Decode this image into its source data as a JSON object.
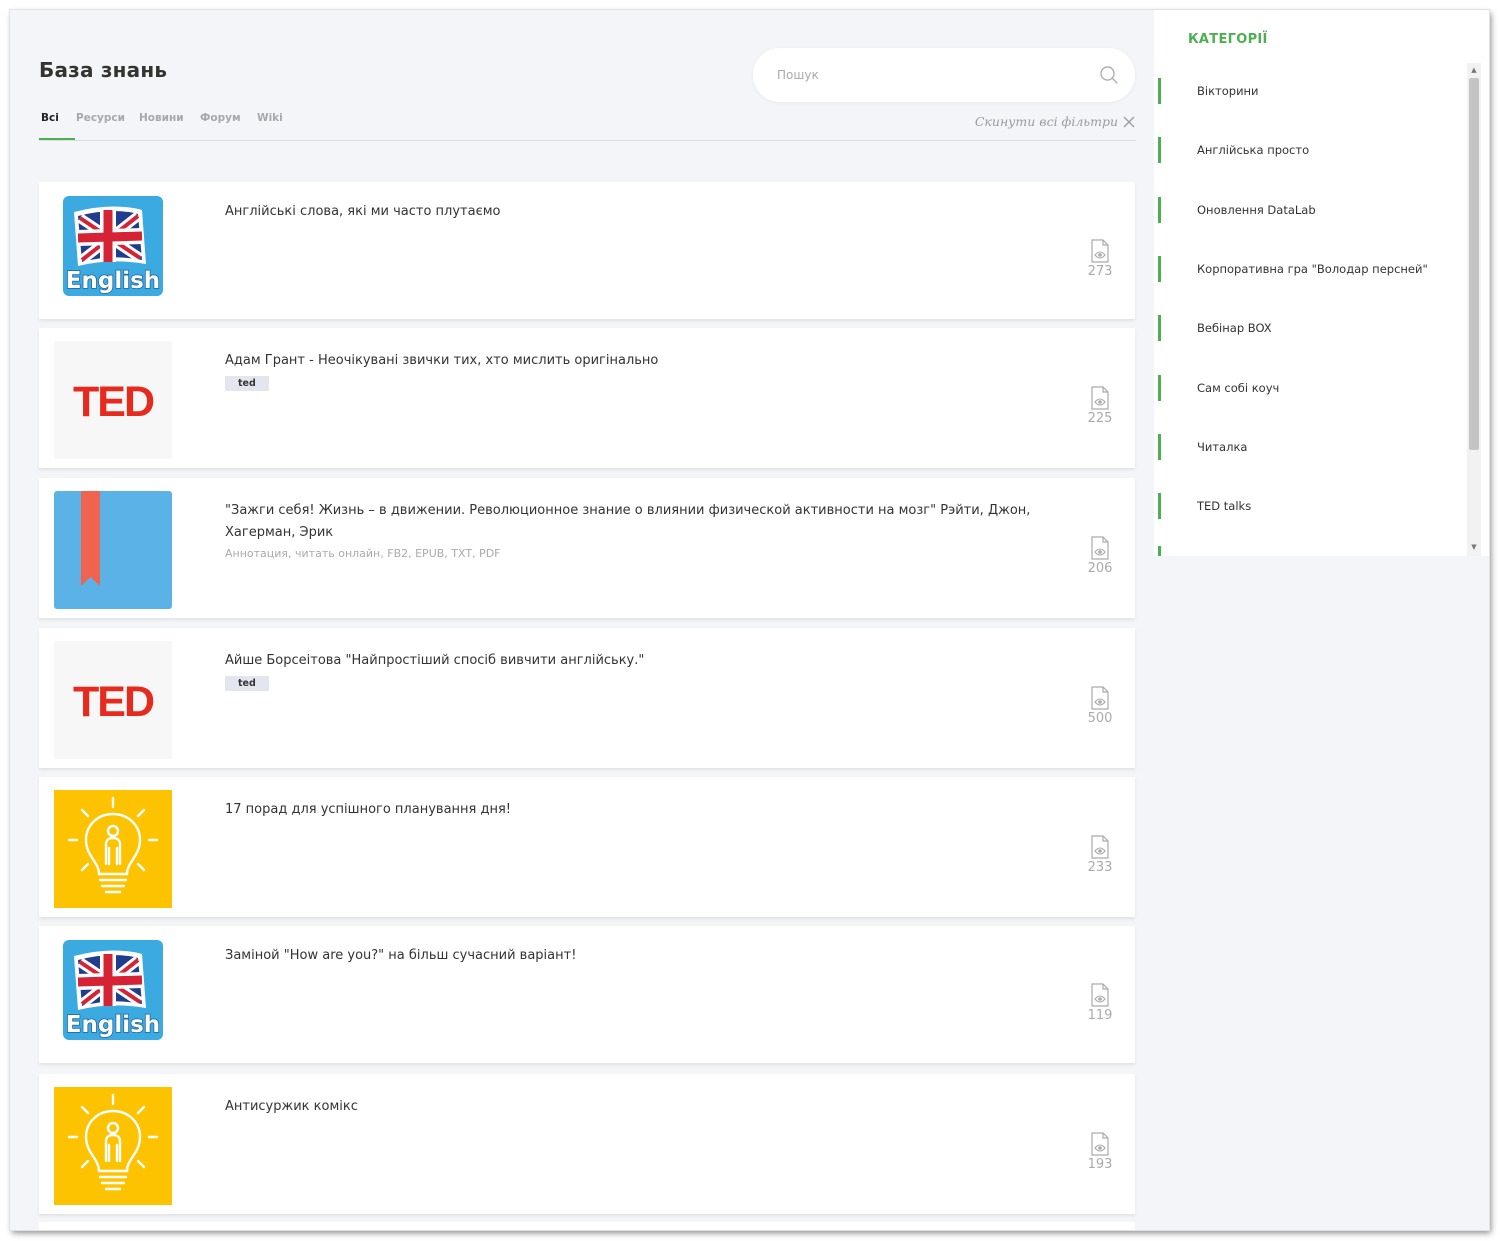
{
  "page": {
    "title": "База знань",
    "search_placeholder": "Пошук",
    "reset_filters": "Скинути всі фільтри"
  },
  "tabs": [
    {
      "label": "Всі",
      "active": true
    },
    {
      "label": "Ресурси",
      "active": false
    },
    {
      "label": "Новини",
      "active": false
    },
    {
      "label": "Форум",
      "active": false
    },
    {
      "label": "Wiki",
      "active": false
    }
  ],
  "articles": [
    {
      "title": "Англійські слова, які ми часто плутаємо",
      "tag": "",
      "subtitle": "",
      "views": "273",
      "thumb": "english-flag-icon"
    },
    {
      "title": "Адам Грант - Неочікувані звички тих, хто мислить оригінально",
      "tag": "ted",
      "subtitle": "",
      "views": "225",
      "thumb": "ted-logo"
    },
    {
      "title": "\"Зажги себя! Жизнь – в движении. Революционное знание о влиянии физической активности на мозг\" Рэйти, Джон, Хагерман, Эрик",
      "tag": "",
      "subtitle": "Аннотация, читать онлайн, FB2, EPUB, TXT, PDF",
      "views": "206",
      "thumb": "bookmark-icon"
    },
    {
      "title": "Айше Борсеітова \"Найпростіший спосіб вивчити англійську.\"",
      "tag": "ted",
      "subtitle": "",
      "views": "500",
      "thumb": "ted-logo"
    },
    {
      "title": "17 порад для успішного планування дня!",
      "tag": "",
      "subtitle": "",
      "views": "233",
      "thumb": "lightbulb-icon"
    },
    {
      "title": "Заміной \"How are you?\" на більш сучасний варіант!",
      "tag": "",
      "subtitle": "",
      "views": "119",
      "thumb": "english-flag-icon"
    },
    {
      "title": "Антисуржик комікс",
      "tag": "",
      "subtitle": "",
      "views": "193",
      "thumb": "lightbulb-icon"
    }
  ],
  "thumb_text": {
    "english": "English",
    "ted": "TED"
  },
  "sidebar": {
    "title": "КАТЕГОРІЇ",
    "items": [
      "Вікторини",
      "Англійська просто",
      "Оновлення DataLab",
      "Корпоративна гра \"Володар персней\"",
      "Вебінар BOX",
      "Сам собі коуч",
      "Читалка",
      "TED talks"
    ]
  },
  "colors": {
    "accent": "#4caf50",
    "english_bg": "#3aaae1",
    "ted_red": "#e62b1e",
    "bookmark_bg": "#5bb2e6",
    "bookmark_ribbon": "#f0644f",
    "lightbulb_bg": "#fdc300"
  }
}
